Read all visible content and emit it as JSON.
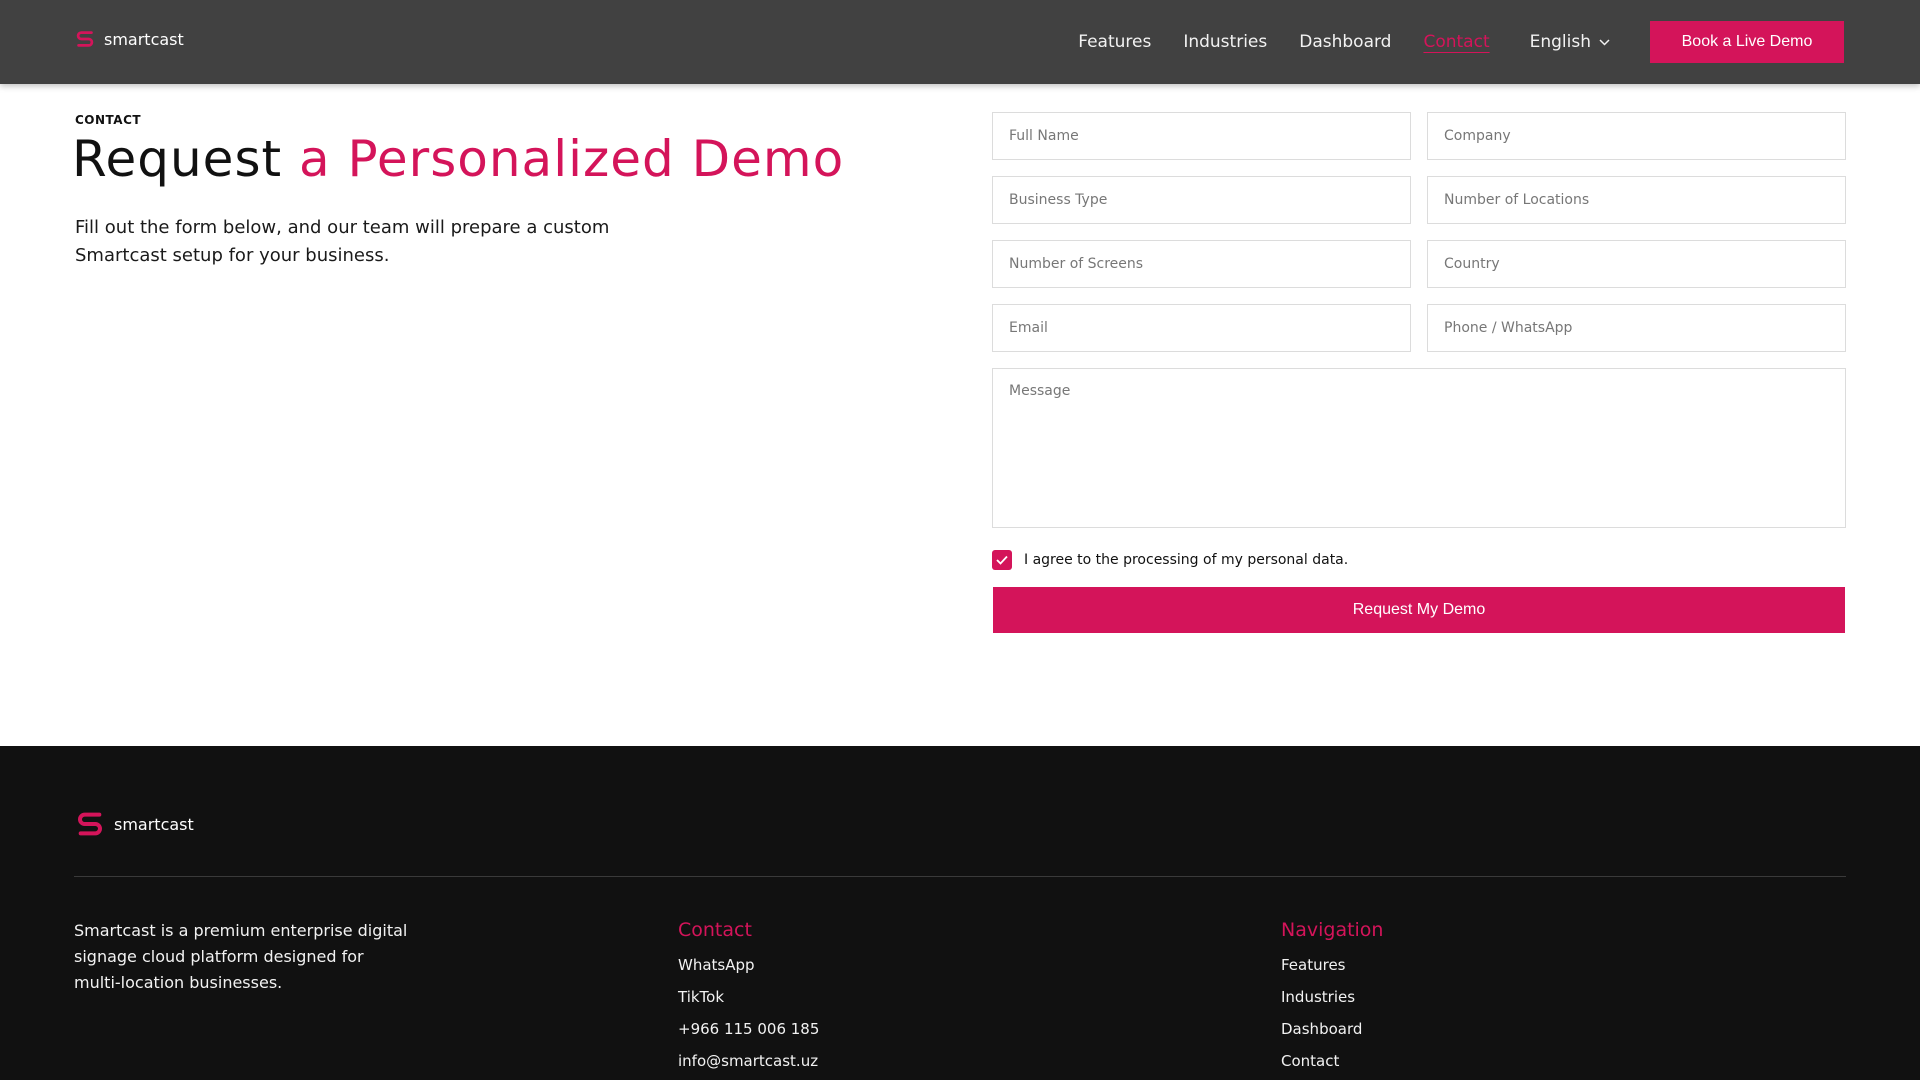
{
  "brand": {
    "name": "smartcast",
    "accent_color": "#d4145a",
    "nav_bg": "#414141",
    "footer_bg": "#111111"
  },
  "nav": {
    "links": [
      "Features",
      "Industries",
      "Dashboard",
      "Contact"
    ],
    "active": "Contact",
    "language": "English",
    "language_icon": "chevron-down-icon",
    "cta_label": "Book a Live Demo"
  },
  "hero": {
    "eyebrow": "CONTACT",
    "title_plain": "Request ",
    "title_accent": "a Personalized Demo",
    "subtitle": "Fill out the form below, and our team will prepare a custom Smartcast setup for your business."
  },
  "form": {
    "full_name_placeholder": "Full Name",
    "company_placeholder": "Company",
    "business_type_placeholder": "Business Type",
    "locations_placeholder": "Number of Locations",
    "screens_placeholder": "Number of Screens",
    "country_placeholder": "Country",
    "email_placeholder": "Email",
    "phone_placeholder": "Phone / WhatsApp",
    "message_placeholder": "Message",
    "consent_checked": true,
    "consent_label": "I agree to the processing of my personal data.",
    "submit_label": "Request My Demo"
  },
  "footer": {
    "description": "Smartcast is a premium enterprise digital signage cloud platform designed for multi-location businesses.",
    "contact": {
      "heading": "Contact",
      "items": [
        "WhatsApp",
        "TikTok",
        "+966 115 006 185",
        "info@smartcast.uz"
      ]
    },
    "navigation": {
      "heading": "Navigation",
      "items": [
        "Features",
        "Industries",
        "Dashboard",
        "Contact"
      ]
    }
  }
}
